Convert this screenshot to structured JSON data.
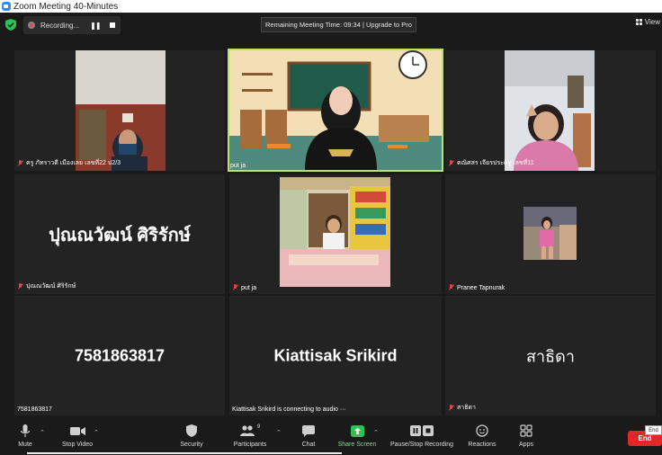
{
  "window": {
    "title": "Zoom Meeting 40-Minutes"
  },
  "recording": {
    "label": "Recording...",
    "pause_glyph": "❚❚"
  },
  "meeting": {
    "remaining": "Remaining Meeting Time: 09:34 | Upgrade to Pro"
  },
  "view": {
    "label": "View"
  },
  "tiles": [
    {
      "name": "ครู ภัทราวดี  เมืองเลย เลขที่22 ป2/3"
    },
    {
      "name": "put ja"
    },
    {
      "name": "คณิศสร เจียรประดิฐ เลขที่11"
    },
    {
      "name": "ปุณณวัฒน์ ศิริรักษ์",
      "big": "ปุณณวัฒน์ ศิริรักษ์"
    },
    {
      "name": "put ja"
    },
    {
      "name": "Pranee Tapnurak"
    },
    {
      "name": "7581863817",
      "big": "7581863817"
    },
    {
      "name": "Kiattisak Srikird is connecting to audio ···",
      "big": "Kiattisak Srikird"
    },
    {
      "name": "สาธิดา",
      "big": "สาธิดา"
    }
  ],
  "toolbar": {
    "mute": "Mute",
    "stop_video": "Stop Video",
    "security": "Security",
    "participants": "Participants",
    "participants_count": "9",
    "chat": "Chat",
    "share_screen": "Share Screen",
    "pause_stop_recording": "Pause/Stop Recording",
    "reactions": "Reactions",
    "apps": "Apps",
    "end": "End",
    "end_tooltip": "End"
  },
  "colors": {
    "share": "#27c453",
    "end": "#e02828",
    "active_speaker": "#b9e36b",
    "muted": "#e0474c"
  }
}
